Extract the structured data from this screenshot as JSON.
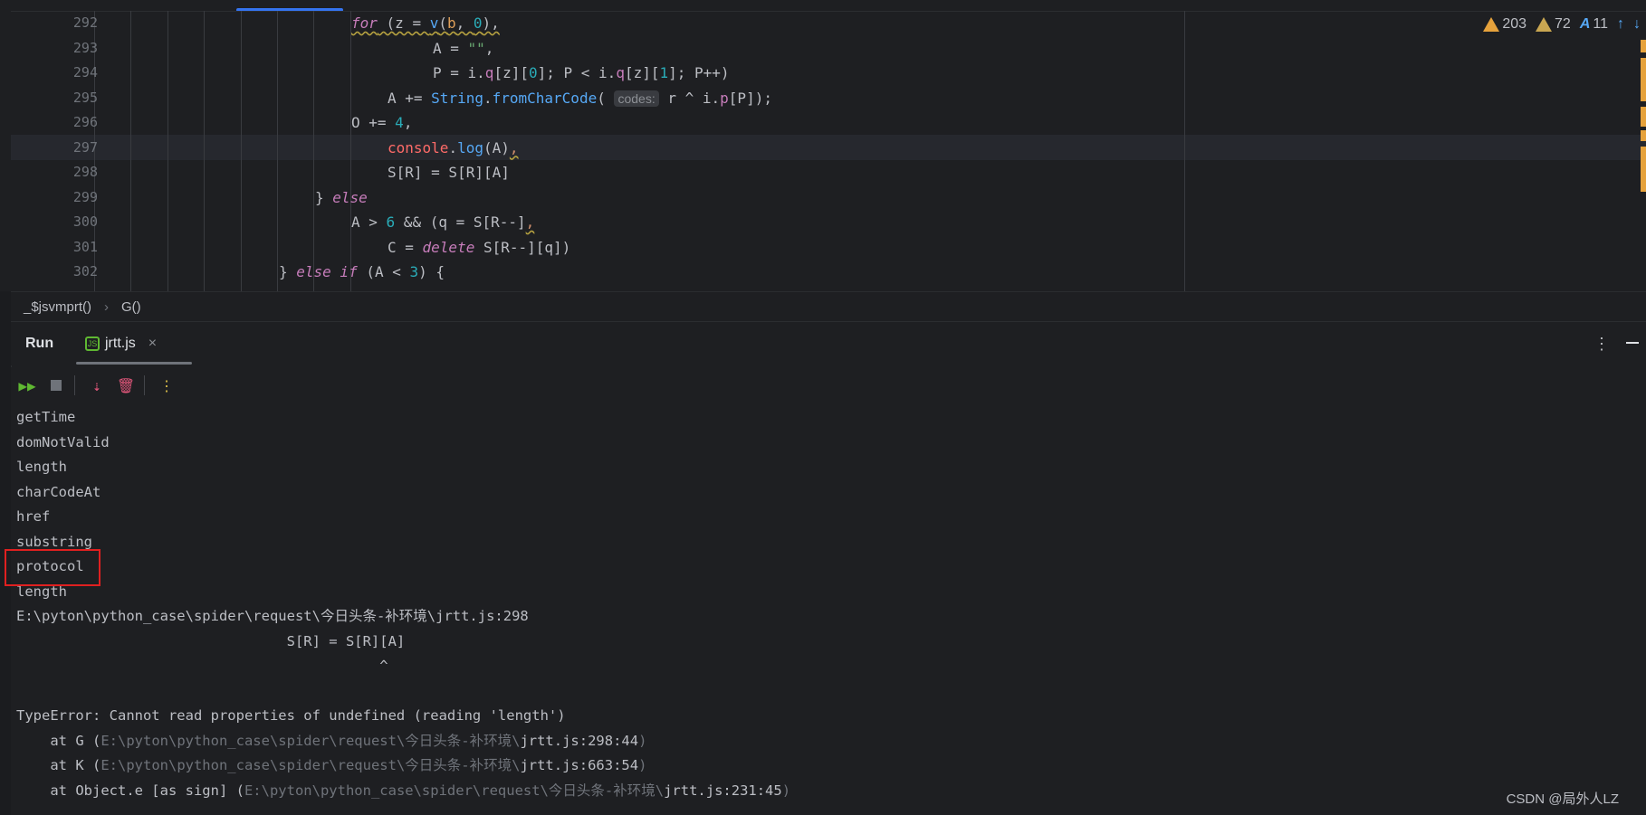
{
  "editor": {
    "inspections": {
      "errors": "203",
      "warnings": "72",
      "typos": "11"
    },
    "lines": [
      {
        "num": "292"
      },
      {
        "num": "293"
      },
      {
        "num": "294"
      },
      {
        "num": "295"
      },
      {
        "num": "296"
      },
      {
        "num": "297"
      },
      {
        "num": "298"
      },
      {
        "num": "299"
      },
      {
        "num": "300"
      },
      {
        "num": "301"
      },
      {
        "num": "302"
      }
    ],
    "inlay_hint": "codes:"
  },
  "breadcrumb": {
    "items": [
      "_$jsvmprt()",
      "G()"
    ]
  },
  "run": {
    "title": "Run",
    "tab_label": "jrtt.js",
    "output": [
      "getTime",
      "domNotValid",
      "length",
      "charCodeAt",
      "href",
      "substring",
      "protocol",
      "length",
      "E:\\pyton\\python_case\\spider\\request\\今日头条-补环境\\jrtt.js:298",
      "                                S[R] = S[R][A]",
      "                                           ^",
      "",
      "TypeError: Cannot read properties of undefined (reading 'length')"
    ],
    "stack": [
      {
        "prefix": "    at G (",
        "path": "E:\\pyton\\python_case\\spider\\request\\今日头条-补环境\\",
        "file": "jrtt.js:298:44",
        "suffix": ")"
      },
      {
        "prefix": "    at K (",
        "path": "E:\\pyton\\python_case\\spider\\request\\今日头条-补环境\\",
        "file": "jrtt.js:663:54",
        "suffix": ")"
      },
      {
        "prefix": "    at Object.e [as sign] (",
        "path": "E:\\pyton\\python_case\\spider\\request\\今日头条-补环境\\",
        "file": "jrtt.js:231:45",
        "suffix": ")"
      }
    ]
  },
  "watermark": "CSDN @局外人LZ",
  "colors": {
    "background": "#1e1f22",
    "warning": "#e6a23c",
    "highlight_box": "#e02020",
    "accent": "#3574f0"
  }
}
